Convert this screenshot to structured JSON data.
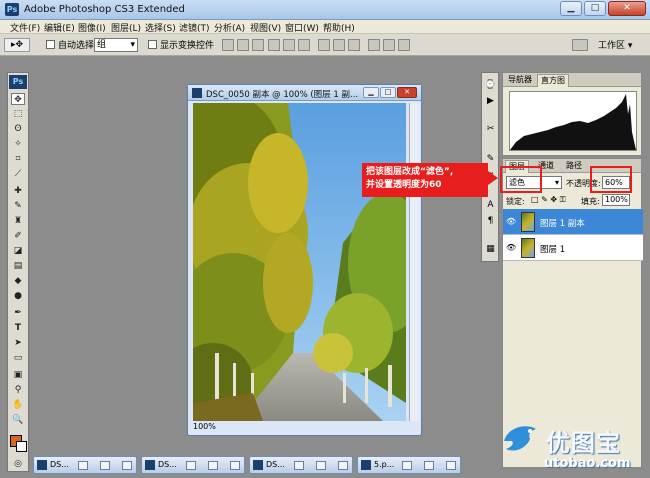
{
  "app": {
    "title": "Adobe Photoshop CS3 Extended",
    "logo": "Ps"
  },
  "menu": [
    "文件(F)",
    "编辑(E)",
    "图像(I)",
    "图层(L)",
    "选择(S)",
    "滤镜(T)",
    "分析(A)",
    "视图(V)",
    "窗口(W)",
    "帮助(H)"
  ],
  "options": {
    "auto_select_label": "自动选择:",
    "auto_select_value": "组",
    "show_transform_label": "显示变换控件",
    "workspace_label": "工作区 ▾"
  },
  "document": {
    "title": "DSC_0050 副本 @ 100% (图层 1 副...",
    "zoom": "100%"
  },
  "nav_panel": {
    "tabs": [
      "导航器",
      "直方图"
    ]
  },
  "layers_panel": {
    "tabs": [
      "图层",
      "通道",
      "路径"
    ],
    "blend_mode": "滤色",
    "opacity_label": "不透明度:",
    "opacity_value": "60%",
    "lock_label": "锁定:",
    "fill_label": "填充:",
    "fill_value": "100%",
    "layers": [
      {
        "name": "图层 1 副本",
        "active": true
      },
      {
        "name": "图层 1",
        "active": false
      }
    ]
  },
  "callout": {
    "line1": "把该图层改成“滤色”,",
    "line2": "并设置透明度为60"
  },
  "taskbar": [
    "DS...",
    "DS...",
    "DS...",
    "5.p..."
  ],
  "watermark": {
    "cn": "优图宝",
    "en": "utobao.com"
  },
  "colors": {
    "foreground": "#d9661a",
    "background": "#ffffff",
    "selection": "#3d88d6",
    "callout": "#e81e1e"
  }
}
